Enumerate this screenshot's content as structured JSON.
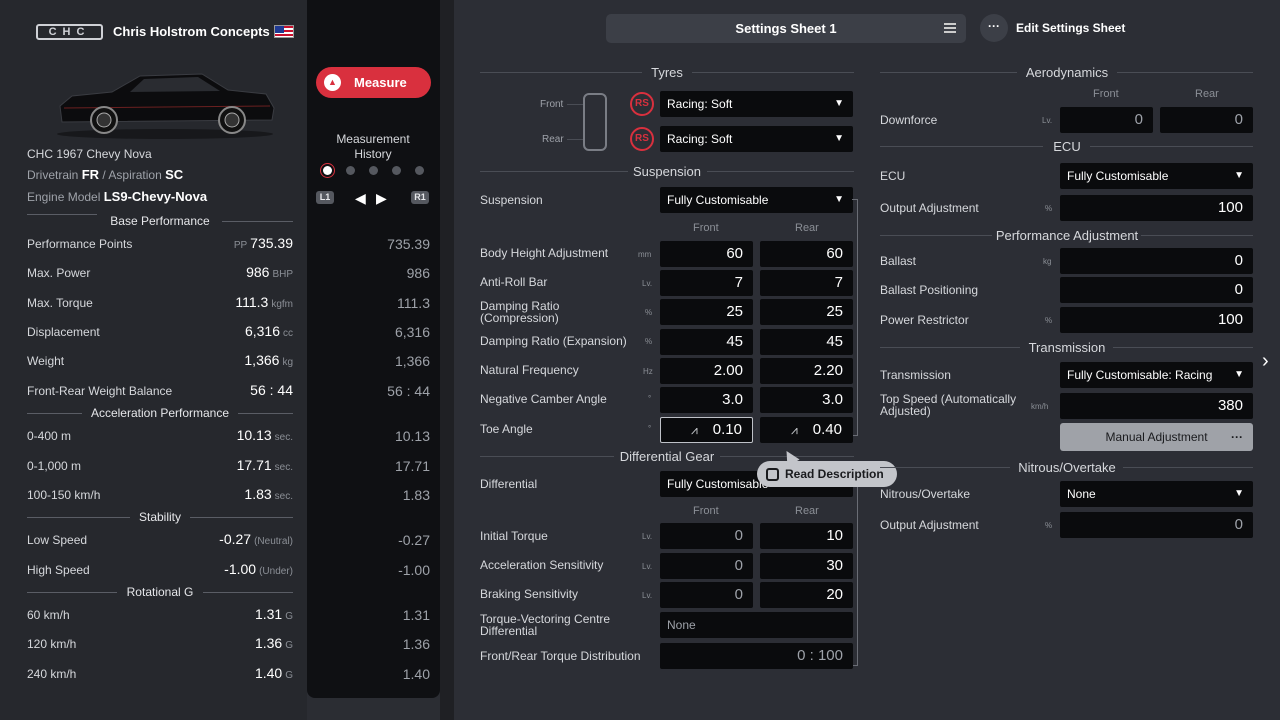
{
  "brand": {
    "logo": "CHC",
    "name": "Chris Holstrom Concepts",
    "flag_icon": "us-flag-icon"
  },
  "car": {
    "title": "CHC 1967 Chevy Nova",
    "drivetrain_label": "Drivetrain",
    "drivetrain": "FR",
    "sep": "/",
    "aspiration_label": "Aspiration",
    "aspiration": "SC",
    "engine_label": "Engine Model",
    "engine": "LS9-Chevy-Nova"
  },
  "measure": {
    "label": "Measure",
    "history_line1": "Measurement",
    "history_line2": "History",
    "l1": "L1",
    "r1": "R1"
  },
  "sections": {
    "base": "Base Performance",
    "accel": "Acceleration Performance",
    "stability": "Stability",
    "rotational": "Rotational G"
  },
  "base_rows": [
    {
      "label": "Performance Points",
      "pre": "PP",
      "value": "735.39",
      "unit": "",
      "compare": "735.39"
    },
    {
      "label": "Max. Power",
      "pre": "",
      "value": "986",
      "unit": "BHP",
      "compare": "986"
    },
    {
      "label": "Max. Torque",
      "pre": "",
      "value": "111.3",
      "unit": "kgfm",
      "compare": "111.3"
    },
    {
      "label": "Displacement",
      "pre": "",
      "value": "6,316",
      "unit": "cc",
      "compare": "6,316"
    },
    {
      "label": "Weight",
      "pre": "",
      "value": "1,366",
      "unit": "kg",
      "compare": "1,366"
    },
    {
      "label": "Front-Rear Weight Balance",
      "pre": "",
      "value": "56 : 44",
      "unit": "",
      "compare": "56 : 44"
    }
  ],
  "accel_rows": [
    {
      "label": "0-400 m",
      "value": "10.13",
      "unit": "sec.",
      "compare": "10.13"
    },
    {
      "label": "0-1,000 m",
      "value": "17.71",
      "unit": "sec.",
      "compare": "17.71"
    },
    {
      "label": "100-150 km/h",
      "value": "1.83",
      "unit": "sec.",
      "compare": "1.83"
    }
  ],
  "stability_rows": [
    {
      "label": "Low Speed",
      "value": "-0.27",
      "unit": "(Neutral)",
      "compare": "-0.27"
    },
    {
      "label": "High Speed",
      "value": "-1.00",
      "unit": "(Under)",
      "compare": "-1.00"
    }
  ],
  "rot_rows": [
    {
      "label": "60 km/h",
      "value": "1.31",
      "unit": "G",
      "compare": "1.31"
    },
    {
      "label": "120 km/h",
      "value": "1.36",
      "unit": "G",
      "compare": "1.36"
    },
    {
      "label": "240 km/h",
      "value": "1.40",
      "unit": "G",
      "compare": "1.40"
    }
  ],
  "topbar": {
    "sheet": "Settings Sheet 1",
    "edit": "Edit Settings Sheet",
    "edit_icon": "···"
  },
  "tyres": {
    "title": "Tyres",
    "front_label": "Front",
    "rear_label": "Rear",
    "badge": "RS",
    "front": "Racing: Soft",
    "rear": "Racing: Soft"
  },
  "suspension": {
    "title": "Suspension",
    "label": "Suspension",
    "value": "Fully Customisable",
    "front_h": "Front",
    "rear_h": "Rear",
    "rows": [
      {
        "label": "Body Height Adjustment",
        "unit": "mm",
        "front": "60",
        "rear": "60"
      },
      {
        "label": "Anti-Roll Bar",
        "unit": "Lv.",
        "front": "7",
        "rear": "7"
      },
      {
        "label": "Damping Ratio\n(Compression)",
        "unit": "%",
        "front": "25",
        "rear": "25"
      },
      {
        "label": "Damping Ratio (Expansion)",
        "unit": "%",
        "front": "45",
        "rear": "45"
      },
      {
        "label": "Natural Frequency",
        "unit": "Hz",
        "front": "2.00",
        "rear": "2.20"
      },
      {
        "label": "Negative Camber Angle",
        "unit": "°",
        "front": "3.0",
        "rear": "3.0"
      },
      {
        "label": "Toe Angle",
        "unit": "°",
        "front": "0.10",
        "rear": "0.40"
      }
    ]
  },
  "differential": {
    "title": "Differential Gear",
    "label": "Differential",
    "value": "Fully Customisable",
    "front_h": "Front",
    "rear_h": "Rear",
    "rows": [
      {
        "label": "Initial Torque",
        "unit": "Lv.",
        "front": "0",
        "rear": "10"
      },
      {
        "label": "Acceleration Sensitivity",
        "unit": "Lv.",
        "front": "0",
        "rear": "30"
      },
      {
        "label": "Braking Sensitivity",
        "unit": "Lv.",
        "front": "0",
        "rear": "20"
      }
    ],
    "tv_label": "Torque-Vectoring Centre\nDifferential",
    "tv_value": "None",
    "dist_label": "Front/Rear Torque Distribution",
    "dist_value": "0 : 100"
  },
  "tooltip": "Read Description",
  "aero": {
    "title": "Aerodynamics",
    "front_h": "Front",
    "rear_h": "Rear",
    "label": "Downforce",
    "unit": "Lv.",
    "front": "0",
    "rear": "0"
  },
  "ecu": {
    "title": "ECU",
    "label": "ECU",
    "value": "Fully Customisable",
    "out_label": "Output Adjustment",
    "out_unit": "%",
    "out_value": "100"
  },
  "perf_adj": {
    "title": "Performance Adjustment",
    "rows": [
      {
        "label": "Ballast",
        "unit": "kg",
        "value": "0"
      },
      {
        "label": "Ballast Positioning",
        "unit": "",
        "value": "0"
      },
      {
        "label": "Power Restrictor",
        "unit": "%",
        "value": "100"
      }
    ]
  },
  "transmission": {
    "title": "Transmission",
    "label": "Transmission",
    "value": "Fully Customisable: Racing",
    "top_label": "Top Speed (Automatically\nAdjusted)",
    "top_unit": "km/h",
    "top_value": "380",
    "manual": "Manual Adjustment",
    "manual_icon": "···"
  },
  "nitrous": {
    "title": "Nitrous/Overtake",
    "label": "Nitrous/Overtake",
    "value": "None",
    "out_label": "Output Adjustment",
    "out_unit": "%",
    "out_value": "0"
  }
}
